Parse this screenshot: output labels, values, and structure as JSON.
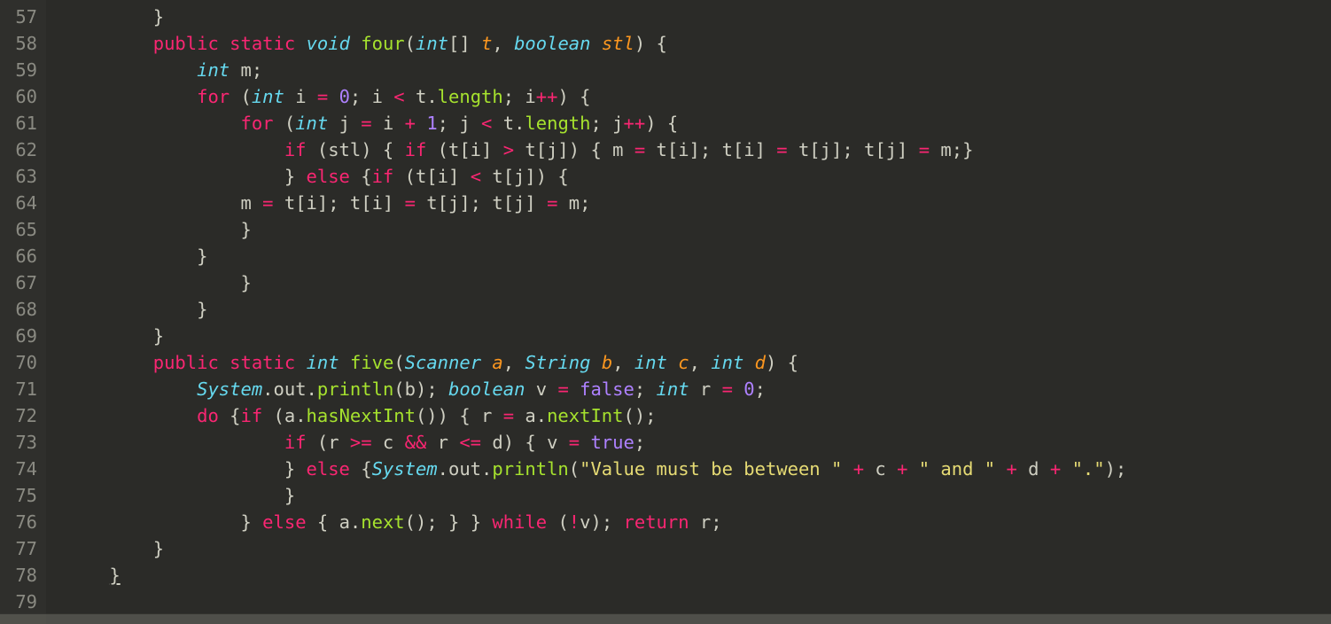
{
  "gutter": {
    "start": 57,
    "end": 79
  },
  "lines": {
    "l57": {
      "indent": "        ",
      "tokens": [
        {
          "t": "}",
          "c": "pn"
        }
      ]
    },
    "l58": {
      "indent": "        ",
      "tokens": [
        {
          "t": "public",
          "c": "kw"
        },
        {
          "t": " ",
          "c": "id"
        },
        {
          "t": "static",
          "c": "kw"
        },
        {
          "t": " ",
          "c": "id"
        },
        {
          "t": "void",
          "c": "ty"
        },
        {
          "t": " ",
          "c": "id"
        },
        {
          "t": "four",
          "c": "fn"
        },
        {
          "t": "(",
          "c": "pn"
        },
        {
          "t": "int",
          "c": "ty"
        },
        {
          "t": "[] ",
          "c": "pn"
        },
        {
          "t": "t",
          "c": "pr"
        },
        {
          "t": ", ",
          "c": "pn"
        },
        {
          "t": "boolean",
          "c": "ty"
        },
        {
          "t": " ",
          "c": "id"
        },
        {
          "t": "stl",
          "c": "pr"
        },
        {
          "t": ") {",
          "c": "pn"
        }
      ]
    },
    "l59": {
      "indent": "            ",
      "tokens": [
        {
          "t": "int",
          "c": "ty"
        },
        {
          "t": " m;",
          "c": "id"
        }
      ]
    },
    "l60": {
      "indent": "            ",
      "tokens": [
        {
          "t": "for",
          "c": "kw"
        },
        {
          "t": " (",
          "c": "pn"
        },
        {
          "t": "int",
          "c": "ty"
        },
        {
          "t": " i ",
          "c": "id"
        },
        {
          "t": "=",
          "c": "op"
        },
        {
          "t": " ",
          "c": "id"
        },
        {
          "t": "0",
          "c": "num"
        },
        {
          "t": "; i ",
          "c": "id"
        },
        {
          "t": "<",
          "c": "op"
        },
        {
          "t": " t.",
          "c": "id"
        },
        {
          "t": "length",
          "c": "fn"
        },
        {
          "t": "; i",
          "c": "id"
        },
        {
          "t": "++",
          "c": "op"
        },
        {
          "t": ") {",
          "c": "pn"
        }
      ]
    },
    "l61": {
      "indent": "                ",
      "tokens": [
        {
          "t": "for",
          "c": "kw"
        },
        {
          "t": " (",
          "c": "pn"
        },
        {
          "t": "int",
          "c": "ty"
        },
        {
          "t": " j ",
          "c": "id"
        },
        {
          "t": "=",
          "c": "op"
        },
        {
          "t": " i ",
          "c": "id"
        },
        {
          "t": "+",
          "c": "op"
        },
        {
          "t": " ",
          "c": "id"
        },
        {
          "t": "1",
          "c": "num"
        },
        {
          "t": "; j ",
          "c": "id"
        },
        {
          "t": "<",
          "c": "op"
        },
        {
          "t": " t.",
          "c": "id"
        },
        {
          "t": "length",
          "c": "fn"
        },
        {
          "t": "; j",
          "c": "id"
        },
        {
          "t": "++",
          "c": "op"
        },
        {
          "t": ") {",
          "c": "pn"
        }
      ]
    },
    "l62": {
      "indent": "                    ",
      "tokens": [
        {
          "t": "if",
          "c": "kw"
        },
        {
          "t": " (stl) { ",
          "c": "id"
        },
        {
          "t": "if",
          "c": "kw"
        },
        {
          "t": " (t[i] ",
          "c": "id"
        },
        {
          "t": ">",
          "c": "op"
        },
        {
          "t": " t[j]) { m ",
          "c": "id"
        },
        {
          "t": "=",
          "c": "op"
        },
        {
          "t": " t[i]; t[i] ",
          "c": "id"
        },
        {
          "t": "=",
          "c": "op"
        },
        {
          "t": " t[j]; t[j] ",
          "c": "id"
        },
        {
          "t": "=",
          "c": "op"
        },
        {
          "t": " m;}",
          "c": "id"
        }
      ]
    },
    "l63": {
      "indent": "                    ",
      "tokens": [
        {
          "t": "} ",
          "c": "id"
        },
        {
          "t": "else",
          "c": "kw"
        },
        {
          "t": " {",
          "c": "id"
        },
        {
          "t": "if",
          "c": "kw"
        },
        {
          "t": " (t[i] ",
          "c": "id"
        },
        {
          "t": "<",
          "c": "op"
        },
        {
          "t": " t[j]) {",
          "c": "id"
        }
      ]
    },
    "l64": {
      "indent": "                ",
      "tokens": [
        {
          "t": "m ",
          "c": "id"
        },
        {
          "t": "=",
          "c": "op"
        },
        {
          "t": " t[i]; t[i] ",
          "c": "id"
        },
        {
          "t": "=",
          "c": "op"
        },
        {
          "t": " t[j]; t[j] ",
          "c": "id"
        },
        {
          "t": "=",
          "c": "op"
        },
        {
          "t": " m;",
          "c": "id"
        }
      ]
    },
    "l65": {
      "indent": "                ",
      "tokens": [
        {
          "t": "}",
          "c": "id"
        }
      ]
    },
    "l66": {
      "indent": "            ",
      "tokens": [
        {
          "t": "}",
          "c": "id"
        }
      ]
    },
    "l67": {
      "indent": "                ",
      "tokens": [
        {
          "t": "}",
          "c": "id"
        }
      ]
    },
    "l68": {
      "indent": "            ",
      "tokens": [
        {
          "t": "}",
          "c": "id"
        }
      ]
    },
    "l69": {
      "indent": "        ",
      "tokens": [
        {
          "t": "}",
          "c": "id"
        }
      ]
    },
    "l70": {
      "indent": "        ",
      "tokens": [
        {
          "t": "public",
          "c": "kw"
        },
        {
          "t": " ",
          "c": "id"
        },
        {
          "t": "static",
          "c": "kw"
        },
        {
          "t": " ",
          "c": "id"
        },
        {
          "t": "int",
          "c": "ty"
        },
        {
          "t": " ",
          "c": "id"
        },
        {
          "t": "five",
          "c": "fn"
        },
        {
          "t": "(",
          "c": "pn"
        },
        {
          "t": "Scanner",
          "c": "ty"
        },
        {
          "t": " ",
          "c": "id"
        },
        {
          "t": "a",
          "c": "pr"
        },
        {
          "t": ", ",
          "c": "pn"
        },
        {
          "t": "String",
          "c": "ty"
        },
        {
          "t": " ",
          "c": "id"
        },
        {
          "t": "b",
          "c": "pr"
        },
        {
          "t": ", ",
          "c": "pn"
        },
        {
          "t": "int",
          "c": "ty"
        },
        {
          "t": " ",
          "c": "id"
        },
        {
          "t": "c",
          "c": "pr"
        },
        {
          "t": ", ",
          "c": "pn"
        },
        {
          "t": "int",
          "c": "ty"
        },
        {
          "t": " ",
          "c": "id"
        },
        {
          "t": "d",
          "c": "pr"
        },
        {
          "t": ") {",
          "c": "pn"
        }
      ]
    },
    "l71": {
      "indent": "            ",
      "tokens": [
        {
          "t": "System",
          "c": "ty"
        },
        {
          "t": ".out.",
          "c": "id"
        },
        {
          "t": "println",
          "c": "fn"
        },
        {
          "t": "(b); ",
          "c": "id"
        },
        {
          "t": "boolean",
          "c": "ty"
        },
        {
          "t": " v ",
          "c": "id"
        },
        {
          "t": "=",
          "c": "op"
        },
        {
          "t": " ",
          "c": "id"
        },
        {
          "t": "false",
          "c": "bool"
        },
        {
          "t": "; ",
          "c": "id"
        },
        {
          "t": "int",
          "c": "ty"
        },
        {
          "t": " r ",
          "c": "id"
        },
        {
          "t": "=",
          "c": "op"
        },
        {
          "t": " ",
          "c": "id"
        },
        {
          "t": "0",
          "c": "num"
        },
        {
          "t": ";",
          "c": "id"
        }
      ]
    },
    "l72": {
      "indent": "            ",
      "tokens": [
        {
          "t": "do",
          "c": "kw"
        },
        {
          "t": " {",
          "c": "id"
        },
        {
          "t": "if",
          "c": "kw"
        },
        {
          "t": " (a.",
          "c": "id"
        },
        {
          "t": "hasNextInt",
          "c": "fn"
        },
        {
          "t": "()) { r ",
          "c": "id"
        },
        {
          "t": "=",
          "c": "op"
        },
        {
          "t": " a.",
          "c": "id"
        },
        {
          "t": "nextInt",
          "c": "fn"
        },
        {
          "t": "();",
          "c": "id"
        }
      ]
    },
    "l73": {
      "indent": "                    ",
      "tokens": [
        {
          "t": "if",
          "c": "kw"
        },
        {
          "t": " (r ",
          "c": "id"
        },
        {
          "t": ">=",
          "c": "op"
        },
        {
          "t": " c ",
          "c": "id"
        },
        {
          "t": "&&",
          "c": "op"
        },
        {
          "t": " r ",
          "c": "id"
        },
        {
          "t": "<=",
          "c": "op"
        },
        {
          "t": " d) { v ",
          "c": "id"
        },
        {
          "t": "=",
          "c": "op"
        },
        {
          "t": " ",
          "c": "id"
        },
        {
          "t": "true",
          "c": "bool"
        },
        {
          "t": ";",
          "c": "id"
        }
      ]
    },
    "l74": {
      "indent": "                    ",
      "tokens": [
        {
          "t": "} ",
          "c": "id"
        },
        {
          "t": "else",
          "c": "kw"
        },
        {
          "t": " {",
          "c": "id"
        },
        {
          "t": "System",
          "c": "ty"
        },
        {
          "t": ".out.",
          "c": "id"
        },
        {
          "t": "println",
          "c": "fn"
        },
        {
          "t": "(",
          "c": "id"
        },
        {
          "t": "\"Value must be between \"",
          "c": "str"
        },
        {
          "t": " ",
          "c": "id"
        },
        {
          "t": "+",
          "c": "op"
        },
        {
          "t": " c ",
          "c": "id"
        },
        {
          "t": "+",
          "c": "op"
        },
        {
          "t": " ",
          "c": "id"
        },
        {
          "t": "\" and \"",
          "c": "str"
        },
        {
          "t": " ",
          "c": "id"
        },
        {
          "t": "+",
          "c": "op"
        },
        {
          "t": " d ",
          "c": "id"
        },
        {
          "t": "+",
          "c": "op"
        },
        {
          "t": " ",
          "c": "id"
        },
        {
          "t": "\".\"",
          "c": "str"
        },
        {
          "t": ");",
          "c": "id"
        }
      ]
    },
    "l75": {
      "indent": "                    ",
      "tokens": [
        {
          "t": "}",
          "c": "id"
        }
      ]
    },
    "l76": {
      "indent": "                ",
      "tokens": [
        {
          "t": "} ",
          "c": "id"
        },
        {
          "t": "else",
          "c": "kw"
        },
        {
          "t": " { a.",
          "c": "id"
        },
        {
          "t": "next",
          "c": "fn"
        },
        {
          "t": "(); } } ",
          "c": "id"
        },
        {
          "t": "while",
          "c": "kw"
        },
        {
          "t": " (",
          "c": "id"
        },
        {
          "t": "!",
          "c": "op"
        },
        {
          "t": "v); ",
          "c": "id"
        },
        {
          "t": "return",
          "c": "kw"
        },
        {
          "t": " r;",
          "c": "id"
        }
      ]
    },
    "l77": {
      "indent": "        ",
      "tokens": [
        {
          "t": "}",
          "c": "id"
        }
      ]
    },
    "l78": {
      "indent": "    ",
      "tokens": [
        {
          "t": "}",
          "c": "id",
          "underline": true
        }
      ]
    },
    "l79": {
      "indent": "",
      "tokens": []
    }
  }
}
